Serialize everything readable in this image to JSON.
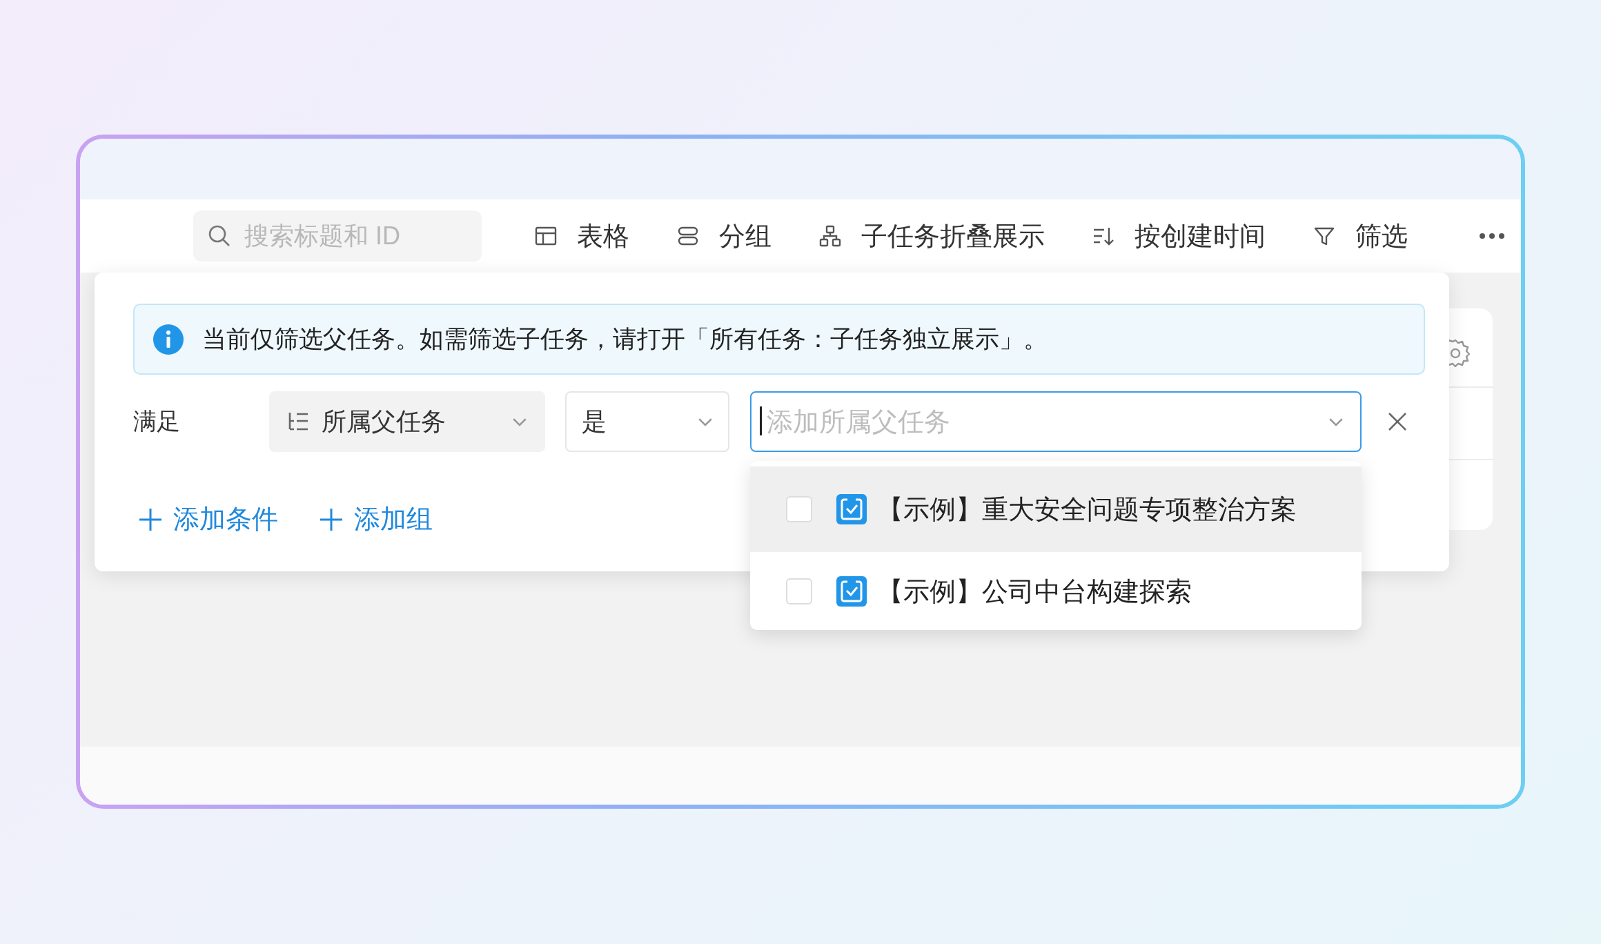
{
  "toolbar": {
    "search": {
      "placeholder": "搜索标题和 ID"
    },
    "items": [
      {
        "kind": "table",
        "label": "表格"
      },
      {
        "kind": "group",
        "label": "分组"
      },
      {
        "kind": "subtask",
        "label": "子任务折叠展示"
      },
      {
        "kind": "sort",
        "label": "按创建时间"
      },
      {
        "kind": "filter",
        "label": "筛选"
      }
    ]
  },
  "filter_panel": {
    "notice": "当前仅筛选父任务。如需筛选子任务，请打开「所有任务：子任务独立展示」。",
    "condition": {
      "match_label": "满足",
      "field": "所属父任务",
      "operator": "是",
      "value": {
        "placeholder": "添加所属父任务"
      }
    },
    "actions": [
      "添加条件",
      "添加组"
    ],
    "dropdown": {
      "options": [
        {
          "label": "【示例】重大安全问题专项整治方案",
          "checked": false,
          "highlighted": true
        },
        {
          "label": "【示例】公司中台构建探索",
          "checked": false,
          "highlighted": false
        }
      ]
    }
  }
}
